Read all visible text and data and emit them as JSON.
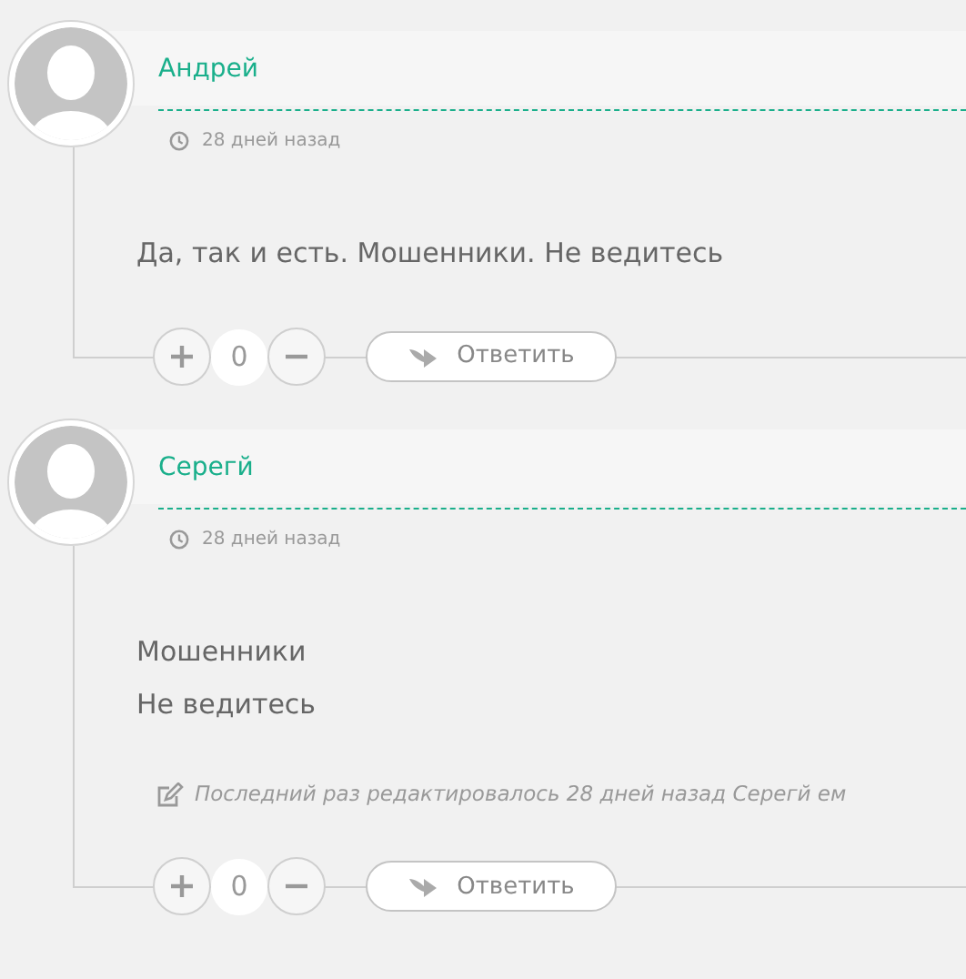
{
  "comments": [
    {
      "author": "Андрей",
      "time": "28 дней назад",
      "body": [
        "Да, так и есть. Мошенники. Не ведитесь"
      ],
      "score": "0",
      "reply_label": "Ответить"
    },
    {
      "author": "Серегй",
      "time": "28 дней назад",
      "body": [
        "Мошенники",
        "Не ведитесь"
      ],
      "edit_note": "Последний раз редактировалось 28 дней назад Серегй ем",
      "score": "0",
      "reply_label": "Ответить"
    }
  ]
}
